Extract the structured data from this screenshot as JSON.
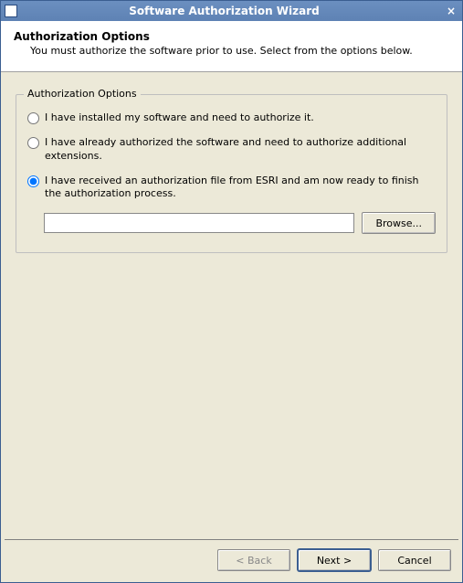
{
  "window": {
    "title": "Software Authorization Wizard",
    "close_glyph": "×"
  },
  "header": {
    "heading": "Authorization Options",
    "subheading": "You must authorize the software prior to use. Select from the options below."
  },
  "group": {
    "legend": "Authorization Options",
    "radios": [
      {
        "label": "I have installed my software and need to authorize it.",
        "checked": false
      },
      {
        "label": "I have already authorized the software and need to authorize additional extensions.",
        "checked": false
      },
      {
        "label": "I have received an authorization file from ESRI and am now ready to finish the authorization process.",
        "checked": true
      }
    ],
    "path_value": "",
    "browse_label": "Browse..."
  },
  "footer": {
    "back_label": "< Back",
    "next_label": "Next >",
    "cancel_label": "Cancel",
    "back_enabled": false
  }
}
